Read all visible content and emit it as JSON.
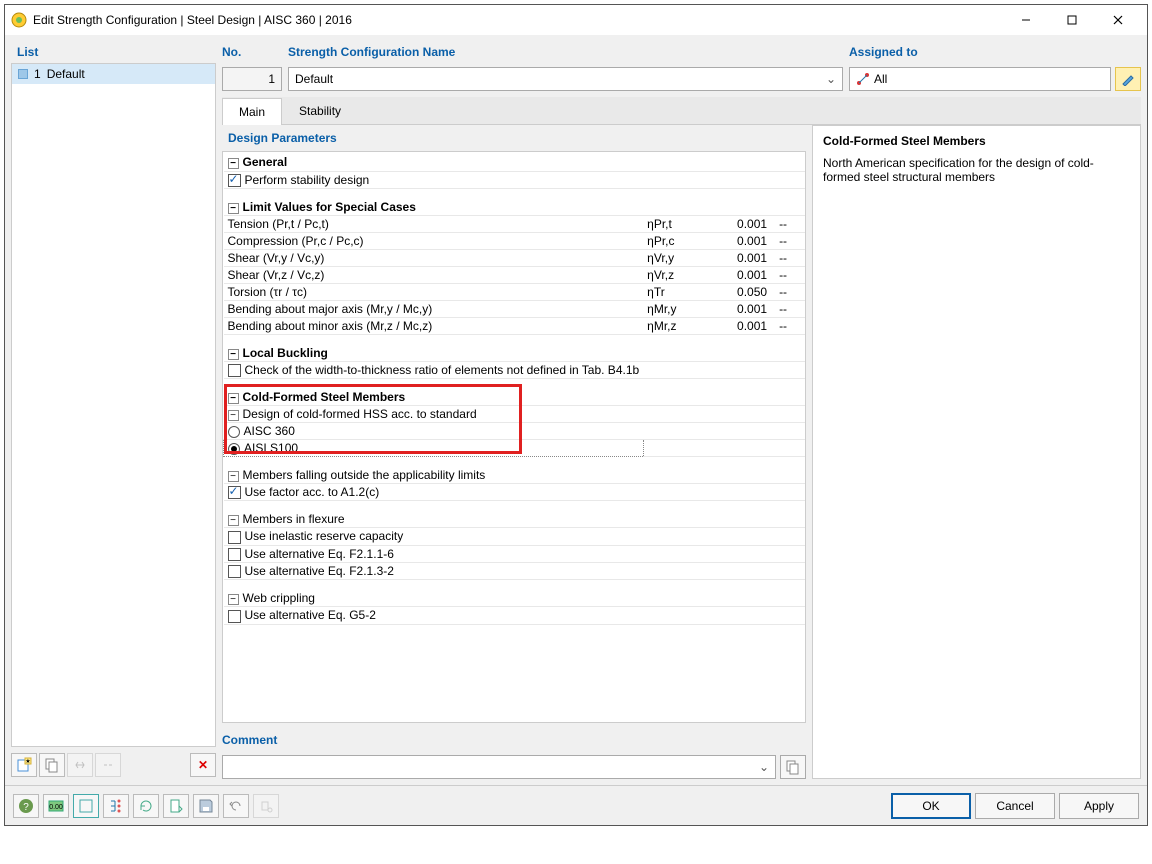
{
  "window": {
    "title": "Edit Strength Configuration | Steel Design | AISC 360 | 2016"
  },
  "left": {
    "header": "List",
    "item_no": "1",
    "item_name": "Default"
  },
  "fields": {
    "no_label": "No.",
    "no_value": "1",
    "name_label": "Strength Configuration Name",
    "name_value": "Default",
    "assigned_label": "Assigned to",
    "assigned_value": "All"
  },
  "tabs": {
    "main": "Main",
    "stability": "Stability"
  },
  "params_header": "Design Parameters",
  "groups": {
    "general": "General",
    "general_perform": "Perform stability design",
    "limit": "Limit Values for Special Cases",
    "local": "Local Buckling",
    "local_check": "Check of the width-to-thickness ratio of elements not defined in Tab. B4.1b",
    "cfs": "Cold-Formed Steel Members",
    "cfs_design": "Design of cold-formed HSS acc. to standard",
    "cfs_aisc": "AISC 360",
    "cfs_aisi": "AISI S100",
    "cfs_outside": "Members falling outside the applicability limits",
    "cfs_usefactor": "Use factor acc. to A1.2(c)",
    "cfs_flex": "Members in flexure",
    "cfs_inelastic": "Use inelastic reserve capacity",
    "cfs_alt1": "Use alternative Eq. F2.1.1-6",
    "cfs_alt2": "Use alternative Eq. F2.1.3-2",
    "cfs_web": "Web crippling",
    "cfs_g52": "Use alternative Eq. G5-2"
  },
  "limits": [
    {
      "label": "Tension (Pr,t / Pc,t)",
      "sym": "ηPr,t",
      "val": "0.001",
      "unit": "--"
    },
    {
      "label": "Compression (Pr,c / Pc,c)",
      "sym": "ηPr,c",
      "val": "0.001",
      "unit": "--"
    },
    {
      "label": "Shear (Vr,y / Vc,y)",
      "sym": "ηVr,y",
      "val": "0.001",
      "unit": "--"
    },
    {
      "label": "Shear (Vr,z / Vc,z)",
      "sym": "ηVr,z",
      "val": "0.001",
      "unit": "--"
    },
    {
      "label": "Torsion (τr / τc)",
      "sym": "ηTr",
      "val": "0.050",
      "unit": "--"
    },
    {
      "label": "Bending about major axis (Mr,y / Mc,y)",
      "sym": "ηMr,y",
      "val": "0.001",
      "unit": "--"
    },
    {
      "label": "Bending about minor axis (Mr,z / Mc,z)",
      "sym": "ηMr,z",
      "val": "0.001",
      "unit": "--"
    }
  ],
  "comment_label": "Comment",
  "info": {
    "title": "Cold-Formed Steel Members",
    "desc": "North American specification for the design of cold-formed steel structural members"
  },
  "buttons": {
    "ok": "OK",
    "cancel": "Cancel",
    "apply": "Apply"
  }
}
